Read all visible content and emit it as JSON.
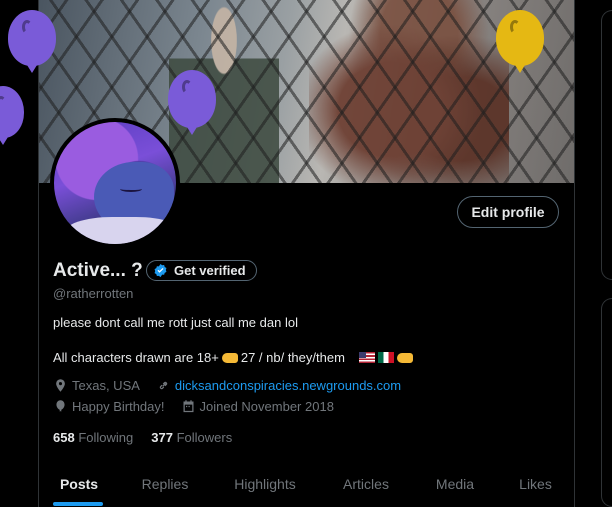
{
  "profile": {
    "display_name": "Active... ?",
    "verify_label": "Get verified",
    "handle": "@ratherrotten",
    "bio_line1": "please dont call me rott just call me dan lol",
    "bio_line2": "All characters drawn are 18+",
    "bio_age_range": "27 / nb/ they/them",
    "location": "Texas, USA",
    "website": "dicksandconspiracies.newgrounds.com",
    "birthday": "Happy Birthday!",
    "joined": "Joined November 2018",
    "following_count": "658",
    "following_label": "Following",
    "followers_count": "377",
    "followers_label": "Followers"
  },
  "actions": {
    "edit_profile": "Edit profile"
  },
  "tabs": [
    {
      "label": "Posts",
      "active": true
    },
    {
      "label": "Replies",
      "active": false
    },
    {
      "label": "Highlights",
      "active": false
    },
    {
      "label": "Articles",
      "active": false
    },
    {
      "label": "Media",
      "active": false
    },
    {
      "label": "Likes",
      "active": false
    }
  ],
  "icons": {
    "verified": "verified-badge-icon",
    "location": "location-pin-icon",
    "link": "link-icon",
    "birthday": "balloon-icon",
    "calendar": "calendar-icon"
  },
  "colors": {
    "accent": "#1d9bf0",
    "background": "#000000",
    "muted": "#71767b",
    "balloon_purple": "#7a5bd8",
    "balloon_yellow": "#e5b813"
  }
}
